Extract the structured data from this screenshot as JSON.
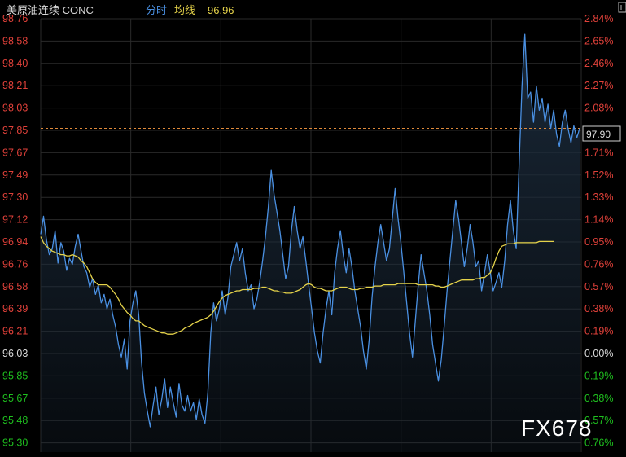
{
  "header": {
    "instrument": "美原油连续 CONC",
    "mode_label": "分时",
    "avg_label": "均线",
    "avg_value": "96.96"
  },
  "watermark": "FX678",
  "colors": {
    "background": "#000000",
    "grid": "#2a2a2a",
    "price_line": "#4a90e2",
    "price_fill_top": "#1b2a3a",
    "avg_line": "#e4d24a",
    "up_text": "#e0413a",
    "down_text": "#1fc01f",
    "flat_text": "#d8d8d8",
    "ref_line": "#e08a3a",
    "last_tag_border": "#cfcfcf"
  },
  "chart_data": {
    "type": "line",
    "title": "",
    "xlabel": "",
    "ylabel": "",
    "ylim": [
      95.21,
      98.81
    ],
    "reference_price": 96.03,
    "last_price": "97.90",
    "left_ticks": [
      "98.76",
      "98.58",
      "98.40",
      "98.21",
      "98.03",
      "97.85",
      "97.67",
      "97.49",
      "97.30",
      "97.12",
      "96.94",
      "96.76",
      "96.58",
      "96.39",
      "96.21",
      "96.03",
      "95.85",
      "95.67",
      "95.48",
      "95.30"
    ],
    "right_ticks": [
      "2.84%",
      "2.65%",
      "2.46%",
      "2.27%",
      "2.08%",
      "1.90%",
      "1.71%",
      "1.52%",
      "1.33%",
      "1.14%",
      "0.95%",
      "0.76%",
      "0.57%",
      "0.38%",
      "0.19%",
      "0.00%",
      "0.19%",
      "0.38%",
      "0.57%",
      "0.76%"
    ],
    "series": [
      {
        "values": [
          97.02,
          97.17,
          96.97,
          96.85,
          96.9,
          97.05,
          96.78,
          96.95,
          96.88,
          96.72,
          96.82,
          96.77,
          96.92,
          97.02,
          96.88,
          96.75,
          96.7,
          96.58,
          96.65,
          96.52,
          96.6,
          96.45,
          96.52,
          96.4,
          96.48,
          96.35,
          96.25,
          96.1,
          96.0,
          96.15,
          95.9,
          96.3,
          96.45,
          96.55,
          96.35,
          95.95,
          95.7,
          95.55,
          95.42,
          95.6,
          95.75,
          95.52,
          95.65,
          95.82,
          95.58,
          95.75,
          95.62,
          95.5,
          95.78,
          95.6,
          95.55,
          95.68,
          95.55,
          95.62,
          95.48,
          95.65,
          95.52,
          95.45,
          95.7,
          96.2,
          96.45,
          96.3,
          96.4,
          96.55,
          96.35,
          96.5,
          96.75,
          96.85,
          96.95,
          96.8,
          96.9,
          96.7,
          96.55,
          96.6,
          96.4,
          96.48,
          96.62,
          96.8,
          97.0,
          97.25,
          97.55,
          97.35,
          97.2,
          97.05,
          96.85,
          96.65,
          96.75,
          97.05,
          97.25,
          97.05,
          96.9,
          97.0,
          96.8,
          96.6,
          96.4,
          96.2,
          96.05,
          95.95,
          96.2,
          96.4,
          96.55,
          96.35,
          96.7,
          96.9,
          97.05,
          96.85,
          96.7,
          96.9,
          96.75,
          96.55,
          96.4,
          96.25,
          96.05,
          95.9,
          96.15,
          96.5,
          96.75,
          96.95,
          97.1,
          96.95,
          96.8,
          96.9,
          97.15,
          97.4,
          97.15,
          96.95,
          96.7,
          96.45,
          96.2,
          96.0,
          96.3,
          96.6,
          96.85,
          96.7,
          96.55,
          96.35,
          96.1,
          95.95,
          95.8,
          95.98,
          96.25,
          96.55,
          96.8,
          97.05,
          97.3,
          97.15,
          96.95,
          96.75,
          96.9,
          97.1,
          96.95,
          96.75,
          96.8,
          96.55,
          96.7,
          96.85,
          96.7,
          96.55,
          96.62,
          96.7,
          96.58,
          96.8,
          97.1,
          97.3,
          97.05,
          96.9,
          97.6,
          98.25,
          98.68,
          98.15,
          98.2,
          97.95,
          98.25,
          98.05,
          98.15,
          97.95,
          98.1,
          97.9,
          98.05,
          97.85,
          97.75,
          97.95,
          98.05,
          97.9,
          97.78,
          97.92,
          97.82,
          97.9
        ]
      },
      {
        "values": [
          97.0,
          96.95,
          96.92,
          96.9,
          96.88,
          96.87,
          96.86,
          96.85,
          96.85,
          96.84,
          96.84,
          96.85,
          96.84,
          96.83,
          96.8,
          96.78,
          96.75,
          96.7,
          96.65,
          96.62,
          96.6,
          96.6,
          96.6,
          96.6,
          96.58,
          96.55,
          96.52,
          96.48,
          96.43,
          96.4,
          96.37,
          96.35,
          96.32,
          96.3,
          96.3,
          96.28,
          96.26,
          96.25,
          96.24,
          96.23,
          96.22,
          96.21,
          96.2,
          96.2,
          96.19,
          96.19,
          96.19,
          96.2,
          96.21,
          96.22,
          96.24,
          96.25,
          96.26,
          96.28,
          96.29,
          96.3,
          96.31,
          96.32,
          96.33,
          96.35,
          96.38,
          96.42,
          96.46,
          96.49,
          96.51,
          96.52,
          96.53,
          96.54,
          96.55,
          96.55,
          96.56,
          96.56,
          96.56,
          96.56,
          96.57,
          96.57,
          96.57,
          96.58,
          96.58,
          96.57,
          96.56,
          96.55,
          96.55,
          96.54,
          96.54,
          96.53,
          96.53,
          96.53,
          96.54,
          96.55,
          96.56,
          96.58,
          96.6,
          96.61,
          96.6,
          96.58,
          96.57,
          96.57,
          96.56,
          96.55,
          96.55,
          96.55,
          96.56,
          96.57,
          96.58,
          96.58,
          96.58,
          96.57,
          96.56,
          96.56,
          96.56,
          96.57,
          96.57,
          96.58,
          96.58,
          96.58,
          96.59,
          96.59,
          96.59,
          96.6,
          96.6,
          96.6,
          96.6,
          96.6,
          96.61,
          96.61,
          96.61,
          96.61,
          96.61,
          96.61,
          96.61,
          96.6,
          96.6,
          96.6,
          96.6,
          96.6,
          96.6,
          96.59,
          96.59,
          96.58,
          96.58,
          96.59,
          96.6,
          96.61,
          96.62,
          96.63,
          96.64,
          96.64,
          96.64,
          96.64,
          96.64,
          96.65,
          96.65,
          96.66,
          96.66,
          96.68,
          96.7,
          96.75,
          96.82,
          96.88,
          96.92,
          96.93,
          96.94,
          96.94,
          96.94,
          96.95,
          96.95,
          96.95,
          96.95,
          96.95,
          96.95,
          96.95,
          96.95,
          96.96,
          96.96,
          96.96,
          96.96,
          96.96,
          96.96
        ]
      }
    ],
    "grid": true,
    "vertical_grid_count": 6
  }
}
